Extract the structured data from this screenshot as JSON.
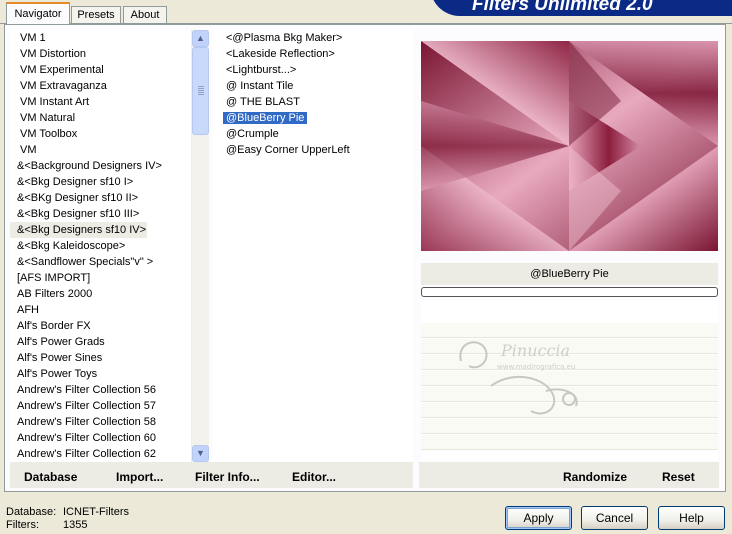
{
  "tabs": [
    {
      "label": "Navigator",
      "active": true
    },
    {
      "label": "Presets",
      "active": false
    },
    {
      "label": "About",
      "active": false
    }
  ],
  "brand": "Filters Unlimited 2.0",
  "categories": [
    "VM 1",
    "VM Distortion",
    "VM Experimental",
    "VM Extravaganza",
    "VM Instant Art",
    "VM Natural",
    "VM Toolbox",
    "VM",
    "&<Background Designers IV>",
    "&<Bkg Designer sf10 I>",
    "&<BKg Designer sf10 II>",
    "&<Bkg Designer sf10 III>",
    "&<Bkg Designers sf10 IV>",
    "&<Bkg Kaleidoscope>",
    "&<Sandflower Specials\"v\" >",
    "[AFS IMPORT]",
    "AB Filters 2000",
    "AFH",
    "Alf's Border FX",
    "Alf's Power Grads",
    "Alf's Power Sines",
    "Alf's Power Toys",
    "Andrew's Filter Collection 56",
    "Andrew's Filter Collection 57",
    "Andrew's Filter Collection 58",
    "Andrew's Filter Collection 60",
    "Andrew's Filter Collection 62"
  ],
  "selected_category": "&<Bkg Designers sf10 IV>",
  "filters": [
    "<@Plasma Bkg Maker>",
    "<Lakeside Reflection>",
    "<Lightburst...>",
    "@ Instant Tile",
    "@ THE BLAST",
    "@BlueBerry Pie",
    "@Crumple",
    "@Easy Corner UpperLeft"
  ],
  "selected_filter": "@BlueBerry Pie",
  "left_buttons": {
    "database": "Database",
    "import": "Import...",
    "filter_info": "Filter Info...",
    "editor": "Editor..."
  },
  "right_buttons": {
    "randomize": "Randomize",
    "reset": "Reset"
  },
  "preview_filter_name": "@BlueBerry Pie",
  "watermark": {
    "name": "Pinuccia",
    "url": "www.madirografica.eu"
  },
  "status": {
    "database_label": "Database:",
    "database_value": "ICNET-Filters",
    "filters_label": "Filters:",
    "filters_value": "1355"
  },
  "dialog_buttons": {
    "apply": "Apply",
    "cancel": "Cancel",
    "help": "Help"
  },
  "icons": {
    "scroll_up": "chevron-up-icon",
    "scroll_down": "chevron-down-icon",
    "scroll_grip": "grip-icon"
  },
  "colors": {
    "selection": "#316ac5",
    "panel_bg": "#ece9d8",
    "brand_bg": "#0b2a86",
    "preview_dark": "#7a1532",
    "preview_light": "#e8a9bf"
  }
}
